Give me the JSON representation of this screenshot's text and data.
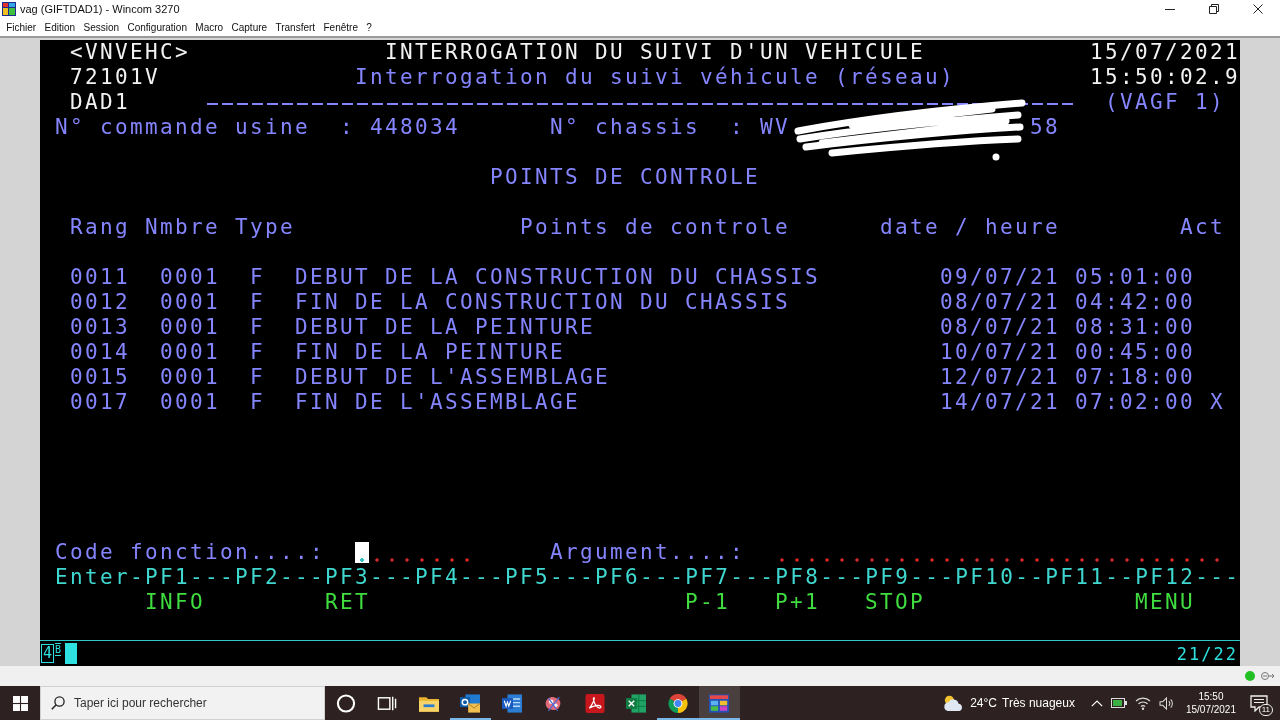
{
  "window": {
    "title": "vag (GIFTDAD1) - Wincom 3270"
  },
  "menu": [
    "Fichier",
    "Edition",
    "Session",
    "Configuration",
    "Macro",
    "Capture",
    "Transfert",
    "Fenêtre",
    "?"
  ],
  "screen": {
    "header": {
      "program": "<VNVEHC>",
      "title": "INTERROGATION DU SUIVI D'UN VEHICULE",
      "date": "15/07/2021",
      "transaction": "72101V",
      "subtitle": "Interrogation du suivi véhicule (réseau)",
      "time": "15:50:02.9",
      "terminal": "DAD1",
      "system": "(VAGF 1)"
    },
    "order": {
      "label": "N° commande usine",
      "separator": ":",
      "value": "448034"
    },
    "chassis": {
      "label": "N° chassis",
      "separator": ":",
      "value_start": "WV",
      "value_end": "58",
      "redacted": true
    },
    "section_title": "POINTS DE CONTROLE",
    "columns": [
      "Rang",
      "Nmbre",
      "Type",
      "Points de controle",
      "date / heure",
      "Act"
    ],
    "rows": [
      {
        "rank": "0011",
        "count": "0001",
        "type": "F",
        "point": "DEBUT DE LA CONSTRUCTION DU CHASSIS",
        "date": "09/07/21",
        "time": "05:01:00"
      },
      {
        "rank": "0012",
        "count": "0001",
        "type": "F",
        "point": "FIN DE LA CONSTRUCTION DU CHASSIS",
        "date": "08/07/21",
        "time": "04:42:00"
      },
      {
        "rank": "0013",
        "count": "0001",
        "type": "F",
        "point": "DEBUT DE LA PEINTURE",
        "date": "08/07/21",
        "time": "08:31:00"
      },
      {
        "rank": "0014",
        "count": "0001",
        "type": "F",
        "point": "FIN DE LA PEINTURE",
        "date": "10/07/21",
        "time": "00:45:00"
      },
      {
        "rank": "0015",
        "count": "0001",
        "type": "F",
        "point": "DEBUT DE L'ASSEMBLAGE",
        "date": "12/07/21",
        "time": "07:18:00"
      },
      {
        "rank": "0017",
        "count": "0001",
        "type": "F",
        "point": "FIN DE L'ASSEMBLAGE",
        "date": "14/07/21",
        "time": "07:02:00",
        "act": "X"
      }
    ],
    "function_field": {
      "label": "Code fonction....:",
      "focused": true
    },
    "argument_field": {
      "label": "Argument....:",
      "focused": false
    },
    "key_line": "Enter-PF1---PF2---PF3---PF4---PF5---PF6---PF7---PF8---PF9---PF10--PF11--PF12---",
    "key_labels": [
      "INFO",
      "RET",
      "P-1",
      "P+1",
      "STOP",
      "MENU"
    ]
  },
  "status_bar": {
    "session": "4",
    "mode": "B",
    "position": "21/22"
  },
  "taskbar": {
    "search_placeholder": "Taper ici pour rechercher",
    "apps": [
      {
        "kind": "circle",
        "running": false,
        "selected": false
      },
      {
        "kind": "task-view",
        "running": false,
        "selected": false
      },
      {
        "kind": "folder",
        "running": false,
        "selected": false
      },
      {
        "kind": "mail",
        "running": true,
        "selected": false
      },
      {
        "kind": "document",
        "running": false,
        "selected": false
      },
      {
        "kind": "splash",
        "running": false,
        "selected": false
      },
      {
        "kind": "pdf",
        "running": false,
        "selected": false
      },
      {
        "kind": "spreadsheet",
        "running": false,
        "selected": false
      },
      {
        "kind": "browser",
        "running": true,
        "selected": false
      },
      {
        "kind": "terminal",
        "running": true,
        "selected": true
      }
    ],
    "weather": {
      "temperature": "24°C",
      "condition": "Très nuageux"
    },
    "clock": {
      "time": "15:50",
      "date": "15/07/2021"
    },
    "notifications": "11"
  }
}
